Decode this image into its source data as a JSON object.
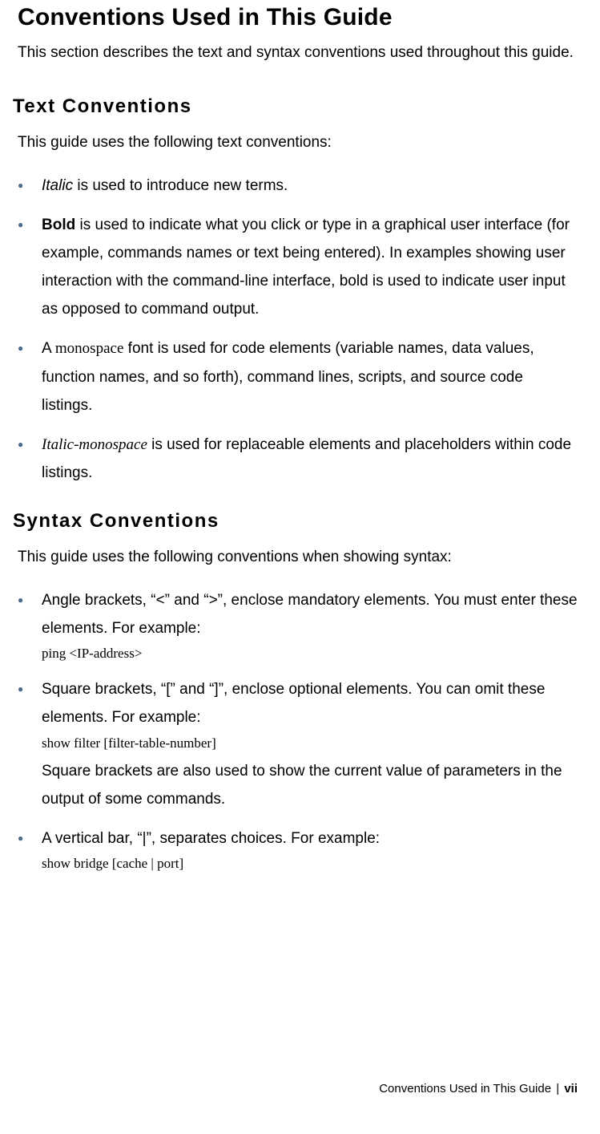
{
  "title": "Conventions Used in This Guide",
  "intro": "This section describes the text and syntax conventions used throughout this guide.",
  "section1": {
    "heading": "Text Conventions",
    "lead": "This guide uses the following text conventions:",
    "items": {
      "0": {
        "prefix": "Italic",
        "rest": " is used to introduce new terms."
      },
      "1": {
        "prefix": "Bold",
        "rest": " is used to indicate what you click or type in a graphical user interface (for example, commands names or text being entered). In examples showing user interaction with the command-line interface, bold is used to indicate user input as opposed to command output."
      },
      "2": {
        "pre": "A ",
        "mono": "monospace",
        "rest": " font is used for code elements (variable names, data values, function names, and so forth), command lines, scripts, and source code listings."
      },
      "3": {
        "mono": "Italic-monospace",
        "rest": " is used for replaceable elements and placeholders within code listings."
      }
    }
  },
  "section2": {
    "heading": "Syntax Conventions",
    "lead": "This guide uses the following conventions when showing syntax:",
    "items": {
      "0": {
        "text": "Angle brackets, “<” and “>”, enclose mandatory elements. You must enter these elements. For example:",
        "code": "ping <IP-address>"
      },
      "1": {
        "text": "Square brackets, “[” and “]”, enclose optional elements. You can omit these elements. For example:",
        "code": "show filter [filter-table-number]",
        "after": "Square brackets are also used to show the current value of parameters in the output of some commands."
      },
      "2": {
        "text": "A vertical bar, “|”, separates choices. For example:",
        "code": "show bridge [cache | port]"
      }
    }
  },
  "footer": {
    "title": "Conventions Used in This Guide",
    "sep": "|",
    "page": "vii"
  }
}
